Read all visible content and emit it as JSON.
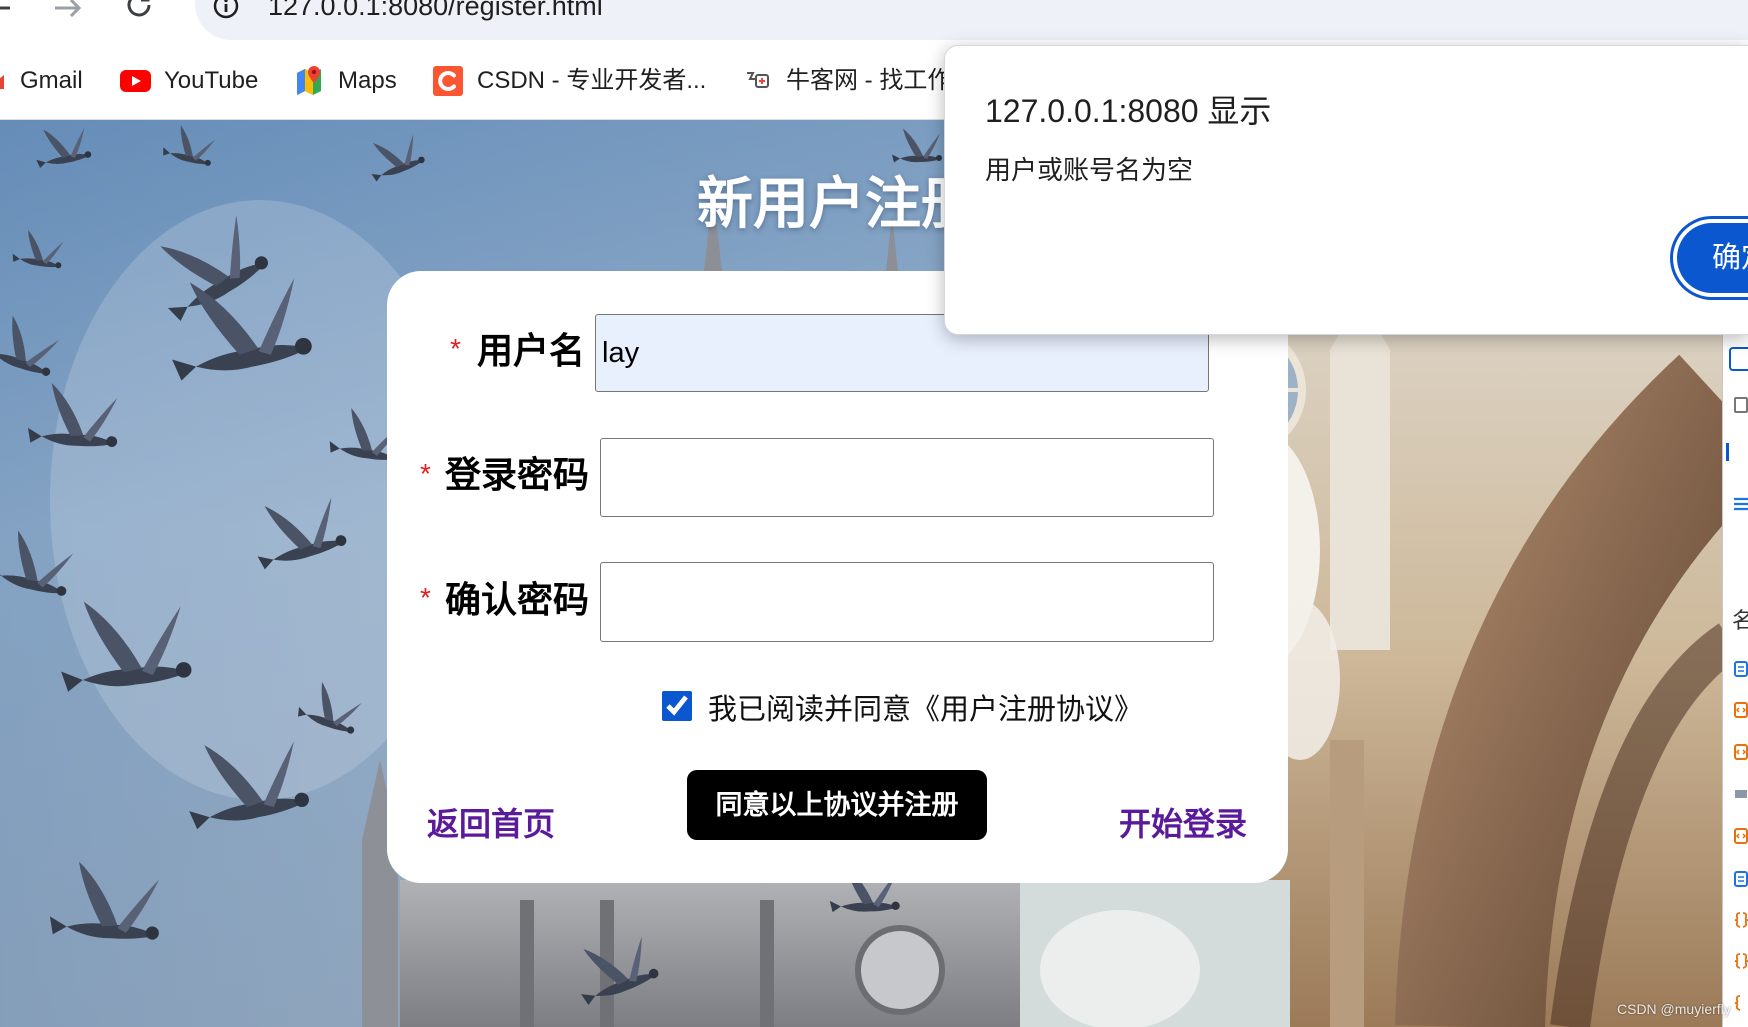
{
  "browser": {
    "url": "127.0.0.1:8080/register.html",
    "icons": [
      "back-arrow-icon",
      "forward-arrow-icon",
      "reload-icon",
      "site-info-icon"
    ]
  },
  "bookmarks": [
    {
      "label": "Gmail",
      "icon": "gmail-icon"
    },
    {
      "label": "YouTube",
      "icon": "youtube-icon"
    },
    {
      "label": "Maps",
      "icon": "maps-icon"
    },
    {
      "label": "CSDN - 专业开发者...",
      "icon": "csdn-icon"
    },
    {
      "label": "牛客网 - 找工作",
      "icon": "nowcoder-icon"
    }
  ],
  "page": {
    "title": "新用户注册",
    "form": {
      "required_mark": "*",
      "username": {
        "label": "用户名",
        "value": "lay"
      },
      "password": {
        "label": "登录密码"
      },
      "confirm": {
        "label": "确认密码"
      },
      "agreement": {
        "checked": true,
        "text": "我已阅读并同意《用户注册协议》"
      },
      "home_link": "返回首页",
      "submit": "同意以上协议并注册",
      "login_link": "开始登录"
    }
  },
  "dialog": {
    "title": "127.0.0.1:8080 显示",
    "message": "用户或账号名为空",
    "ok": "确定"
  },
  "devtools": {
    "column_header": "名"
  },
  "watermark": "CSDN @muyierfly",
  "colors": {
    "accent": "#0b57d0",
    "link": "#5a1a9a",
    "required": "#e02020",
    "autofill_bg": "#e8f0fe",
    "submit_bg": "#000000",
    "title_text": "#ffffff"
  }
}
